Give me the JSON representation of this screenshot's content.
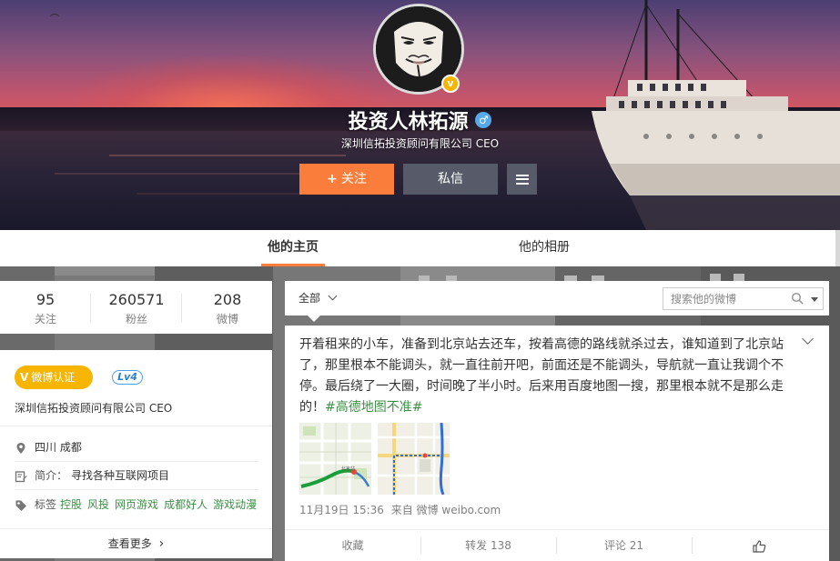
{
  "profile": {
    "name": "投资人林拓源",
    "gender_symbol": "♂",
    "verified_mark": "v",
    "subtitle": "深圳信拓投资顾问有限公司 CEO",
    "follow_label": "关注",
    "follow_plus": "+",
    "message_label": "私信"
  },
  "tabs": [
    {
      "label": "他的主页",
      "active": true
    },
    {
      "label": "他的相册",
      "active": false
    }
  ],
  "stats": [
    {
      "value": "95",
      "label": "关注"
    },
    {
      "value": "260571",
      "label": "粉丝"
    },
    {
      "value": "208",
      "label": "微博"
    }
  ],
  "info": {
    "cert_mark": "V",
    "cert_label": "微博认证",
    "level": "Lv4",
    "description": "深圳信拓投资顾问有限公司 CEO",
    "location": "四川 成都",
    "bio_key": "简介：",
    "bio_value": "寻找各种互联网项目",
    "tags_key": "标签",
    "tags": [
      "控股",
      "风投",
      "网页游戏",
      "成都好人",
      "游戏动漫"
    ],
    "more_label": "查看更多",
    "more_arrow": "›"
  },
  "filter": {
    "label": "全部",
    "search_placeholder": "搜索他的微博"
  },
  "post": {
    "text": "开着租来的小车，准备到北京站去还车，按着高德的路线就杀过去，谁知道到了北京站了，那里根本不能调头，就一直往前开吧，前面还是不能调头，导航就一直让我调个不停。最后绕了一大圈，时间晚了半小时。后来用百度地图一搜，那里根本就不是那么走的！",
    "hashtag": "#高德地图不准#",
    "time": "11月19日 15:36",
    "source_prefix": "来自",
    "source": "微博 weibo.com",
    "map_label": "北京站",
    "actions": {
      "favorite": "收藏",
      "repost": "转发 138",
      "comment": "评论 21"
    }
  },
  "icons": {
    "location": "location-pin-icon",
    "bio": "edit-icon",
    "tag": "tag-icon",
    "search": "search-icon",
    "like": "thumbs-up-icon",
    "menu": "menu-icon"
  },
  "colors": {
    "accent": "#fa7d3c",
    "verified": "#f7b500",
    "tag_green": "#3c8f45",
    "level_blue": "#2d80d0"
  }
}
